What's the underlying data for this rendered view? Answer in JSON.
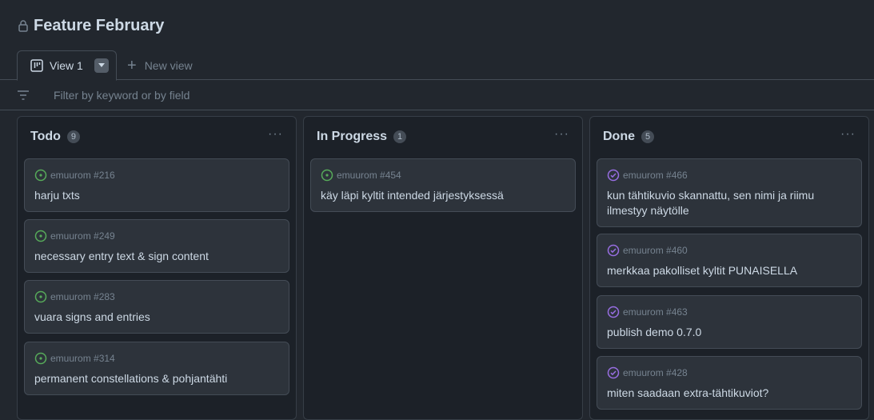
{
  "project": {
    "title": "Feature February"
  },
  "tabs": {
    "active_label": "View 1",
    "new_view_label": "New view"
  },
  "filter": {
    "placeholder": "Filter by keyword or by field"
  },
  "colors": {
    "open": "#57ab5a",
    "done": "#986ee2"
  },
  "columns": [
    {
      "title": "Todo",
      "count": "9",
      "cards": [
        {
          "ref": "emuurom #216",
          "title": "harju txts",
          "status": "open"
        },
        {
          "ref": "emuurom #249",
          "title": "necessary entry text & sign content",
          "status": "open"
        },
        {
          "ref": "emuurom #283",
          "title": "vuara signs and entries",
          "status": "open"
        },
        {
          "ref": "emuurom #314",
          "title": "permanent constellations & pohjantähti",
          "status": "open"
        }
      ]
    },
    {
      "title": "In Progress",
      "count": "1",
      "cards": [
        {
          "ref": "emuurom #454",
          "title": "käy läpi kyltit intended järjestyksessä",
          "status": "open"
        }
      ]
    },
    {
      "title": "Done",
      "count": "5",
      "cards": [
        {
          "ref": "emuurom #466",
          "title": "kun tähtikuvio skannattu, sen nimi ja riimu ilmestyy näytölle",
          "status": "done"
        },
        {
          "ref": "emuurom #460",
          "title": "merkkaa pakolliset kyltit PUNAISELLA",
          "status": "done"
        },
        {
          "ref": "emuurom #463",
          "title": "publish demo 0.7.0",
          "status": "done"
        },
        {
          "ref": "emuurom #428",
          "title": "miten saadaan extra-tähtikuviot?",
          "status": "done"
        }
      ]
    }
  ]
}
